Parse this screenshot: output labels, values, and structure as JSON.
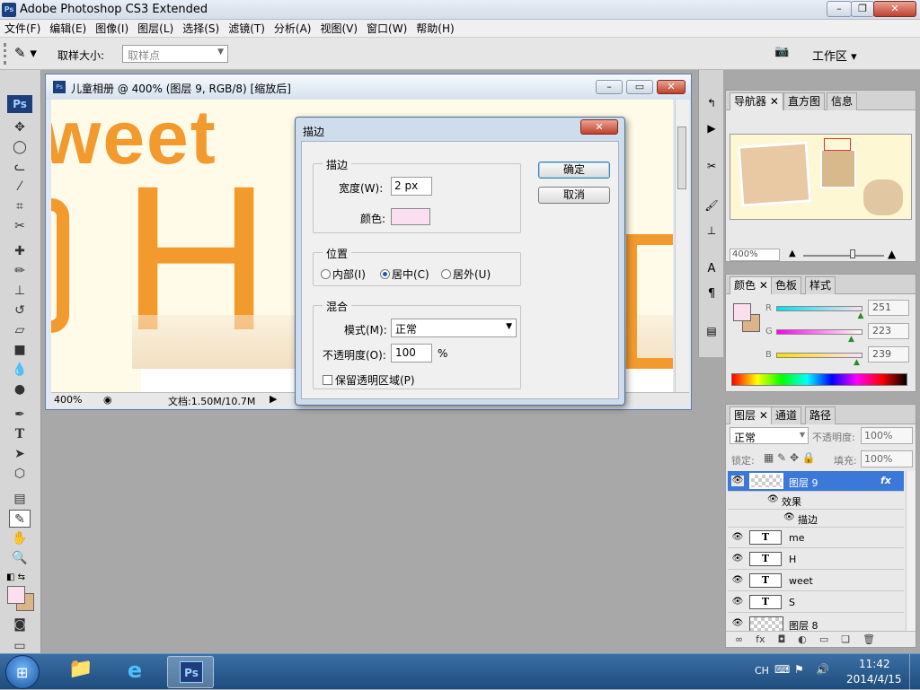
{
  "app": {
    "title": "Adobe Photoshop CS3 Extended",
    "ps_icon": "Ps"
  },
  "menu": [
    "文件(F)",
    "编辑(E)",
    "图像(I)",
    "图层(L)",
    "选择(S)",
    "滤镜(T)",
    "分析(A)",
    "视图(V)",
    "窗口(W)",
    "帮助(H)"
  ],
  "options": {
    "sample_label": "取样大小:",
    "sample_value": "取样点",
    "workspace": "工作区 ▾"
  },
  "document": {
    "title": "儿童相册 @ 400% (图层 9, RGB/8) [缩放后]",
    "zoom": "400%",
    "doc_info": "文档:1.50M/10.7M",
    "canvas_text_1": "weet",
    "canvas_text_2": "H"
  },
  "dialog": {
    "title": "描边",
    "stroke_group": "描边",
    "width_label": "宽度(W):",
    "width_value": "2 px",
    "color_label": "颜色:",
    "color_value": "#f9dff0",
    "position_group": "位置",
    "pos_inside": "内部(I)",
    "pos_center": "居中(C)",
    "pos_outside": "居外(U)",
    "blend_group": "混合",
    "mode_label": "模式(M):",
    "mode_value": "正常",
    "opacity_label": "不透明度(O):",
    "opacity_value": "100",
    "opacity_unit": "%",
    "preserve_label": "保留透明区域(P)",
    "ok": "确定",
    "cancel": "取消"
  },
  "navigator": {
    "tabs": [
      "导航器",
      "直方图",
      "信息"
    ],
    "zoom": "400%"
  },
  "color_panel": {
    "tabs": [
      "颜色",
      "色板",
      "样式"
    ],
    "channels": [
      {
        "label": "R",
        "value": "251",
        "fraction": 0.984
      },
      {
        "label": "G",
        "value": "223",
        "fraction": 0.875
      },
      {
        "label": "B",
        "value": "239",
        "fraction": 0.937
      }
    ],
    "foreground": "#fbdfef",
    "background": "#dcb48a"
  },
  "layers_panel": {
    "tabs": [
      "图层",
      "通道",
      "路径"
    ],
    "blend_mode": "正常",
    "opacity_label": "不透明度:",
    "opacity_value": "100%",
    "lock_label": "锁定:",
    "fill_label": "填充:",
    "fill_value": "100%",
    "layers": [
      {
        "name": "图层 9",
        "type": "pixel",
        "selected": true,
        "fx": "fx"
      },
      {
        "name": "效果",
        "type": "effect"
      },
      {
        "name": "描边",
        "type": "effect-item"
      },
      {
        "name": "me",
        "type": "text"
      },
      {
        "name": "H",
        "type": "text"
      },
      {
        "name": "weet",
        "type": "text"
      },
      {
        "name": "S",
        "type": "text"
      },
      {
        "name": "图层 8",
        "type": "pixel"
      }
    ]
  },
  "taskbar": {
    "lang": "CH",
    "time": "11:42",
    "date": "2014/4/15"
  }
}
